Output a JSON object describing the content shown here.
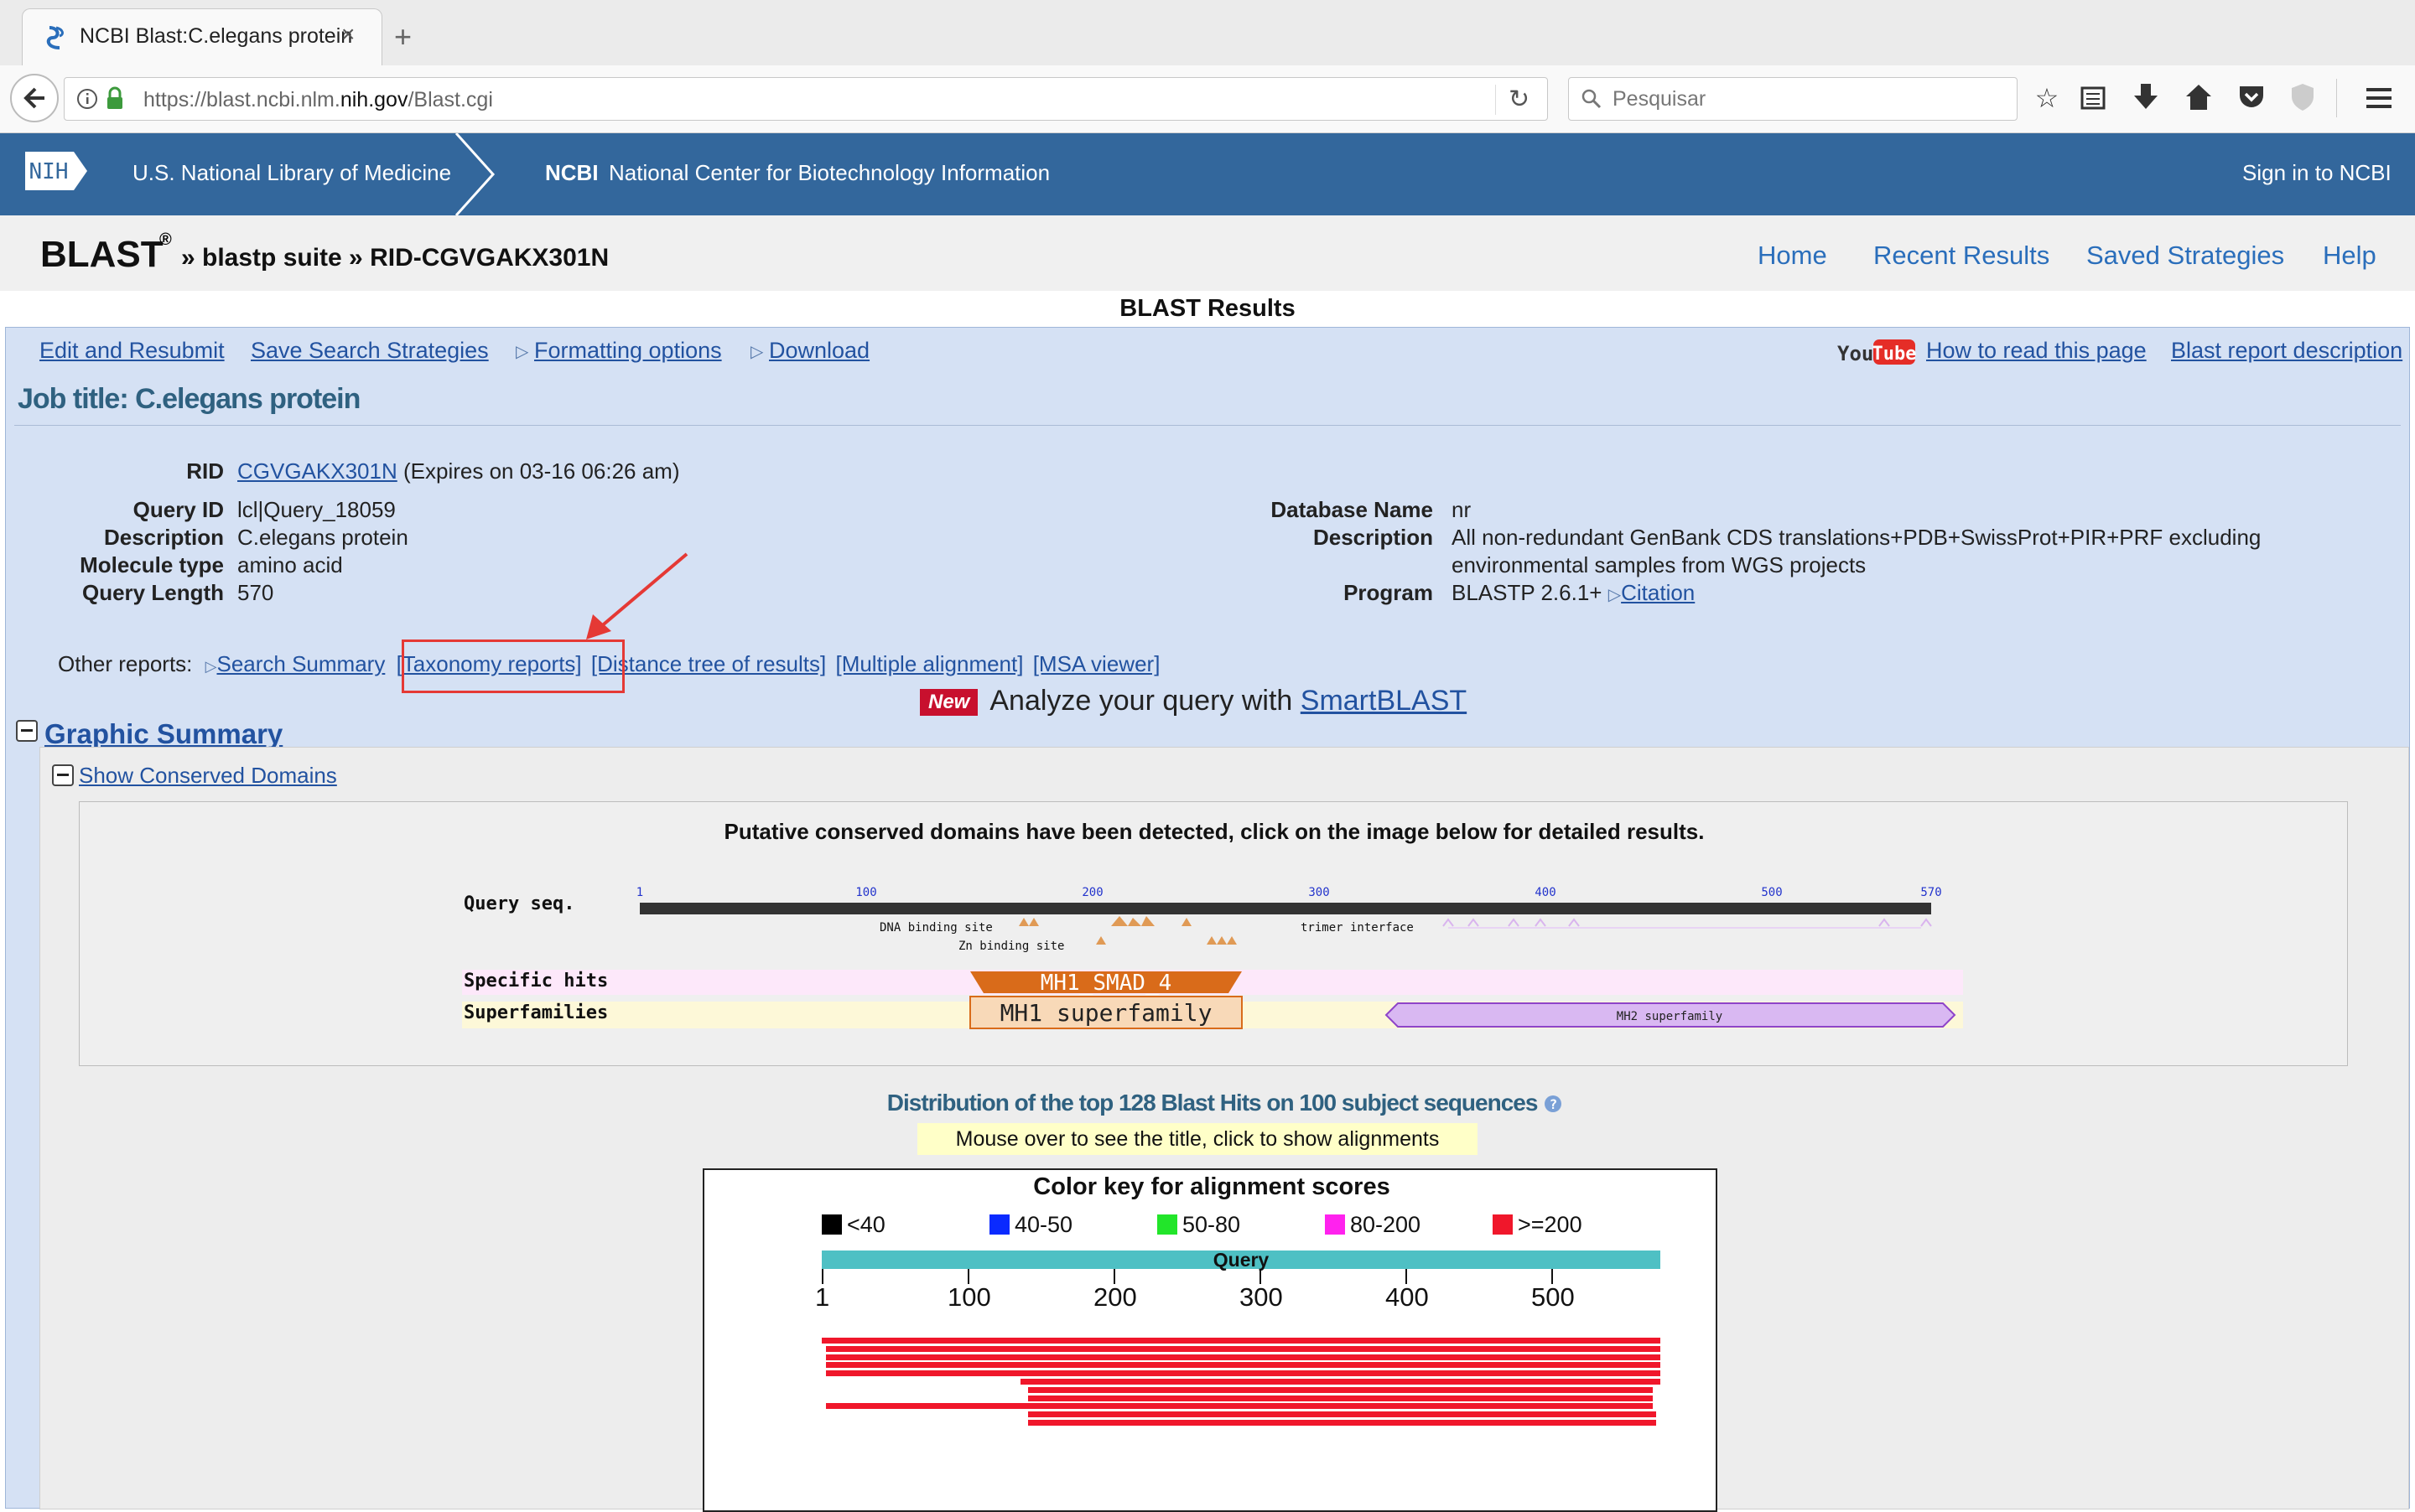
{
  "browser": {
    "tab_title": "NCBI Blast:C.elegans protein",
    "url_prefix": "https://blast.ncbi.nlm.",
    "url_domain": "nih.gov",
    "url_suffix": "/Blast.cgi",
    "search_placeholder": "Pesquisar"
  },
  "nih_bar": {
    "logo_text": "NIH",
    "library": "U.S. National Library of Medicine",
    "ncbi_short": "NCBI",
    "ncbi_full": "National Center for Biotechnology Information",
    "sign_in": "Sign in to NCBI"
  },
  "blast_header": {
    "title": "BLAST",
    "registered": "®",
    "breadcrumb": "» blastp suite » RID-CGVGAKX301N",
    "nav": [
      "Home",
      "Recent Results",
      "Saved Strategies",
      "Help"
    ]
  },
  "page_title": "BLAST Results",
  "toolbar": {
    "edit_resubmit": "Edit and Resubmit",
    "save_strategies": "Save Search Strategies",
    "formatting": "Formatting options ",
    "download": "Download",
    "youtube": "YouTube",
    "how_to_read": "How to read this page",
    "report_desc": "Blast report description"
  },
  "job_title": "Job title: C.elegans protein",
  "query_info": {
    "rid_label": "RID",
    "rid_value": "CGVGAKX301N",
    "rid_expiry": "(Expires on 03-16 06:26 am)",
    "query_id_label": "Query ID",
    "query_id": "lcl|Query_18059",
    "description_label": "Description",
    "description": "C.elegans protein",
    "molecule_type_label": "Molecule type",
    "molecule_type": "amino acid",
    "query_length_label": "Query Length",
    "query_length": "570"
  },
  "database_info": {
    "db_name_label": "Database Name",
    "db_name": "nr",
    "description_label": "Description",
    "description_line1": "All non-redundant GenBank CDS translations+PDB+SwissProt+PIR+PRF excluding",
    "description_line2": "environmental samples from WGS projects",
    "program_label": "Program",
    "program": "BLASTP 2.6.1+",
    "citation": "Citation"
  },
  "other_reports": {
    "label": "Other reports:",
    "search_summary": "Search Summary",
    "taxonomy": "[Taxonomy reports]",
    "distance_tree": "[Distance tree of results]",
    "multiple_alignment": "[Multiple alignment]",
    "msa_viewer": "[MSA viewer]"
  },
  "smartblast": {
    "badge": "New",
    "text": "Analyze your query with ",
    "link": "SmartBLAST"
  },
  "graphic_summary": {
    "heading": "Graphic Summary",
    "show_domains": "Show Conserved Domains",
    "domains_title": "Putative conserved domains have been detected, click on the image below for detailed results.",
    "domain_labels": {
      "query_seq": "Query seq.",
      "specific_hits": "Specific hits",
      "superfamilies": "Superfamilies",
      "dna_binding": "DNA binding site",
      "zn_binding": "Zn binding site",
      "trimer": "trimer interface",
      "specific_hit_name": "MH1_SMAD_4",
      "superfamily_1": "MH1 superfamily",
      "superfamily_2": "MH2 superfamily",
      "ruler_ticks": [
        "1",
        "100",
        "200",
        "300",
        "400",
        "500",
        "570"
      ]
    },
    "distribution_title": "Distribution of the top 128 Blast Hits on 100 subject sequences",
    "mouse_hint": "Mouse over to see the title, click to show alignments",
    "color_key_title": "Color key for alignment scores",
    "color_key": [
      {
        "label": "<40",
        "color": "#000000"
      },
      {
        "label": "40-50",
        "color": "#0a2aff"
      },
      {
        "label": "50-80",
        "color": "#22e52a"
      },
      {
        "label": "80-200",
        "color": "#ff22ee"
      },
      {
        "label": ">=200",
        "color": "#f0172b"
      }
    ],
    "query_label": "Query",
    "axis_ticks": [
      "1",
      "100",
      "200",
      "300",
      "400",
      "500"
    ]
  },
  "chart_data": {
    "type": "bar",
    "hits": [
      {
        "start": 1,
        "end": 570
      },
      {
        "start": 4,
        "end": 570
      },
      {
        "start": 4,
        "end": 570
      },
      {
        "start": 4,
        "end": 570
      },
      {
        "start": 4,
        "end": 570
      },
      {
        "start": 136,
        "end": 570
      },
      {
        "start": 141,
        "end": 565
      },
      {
        "start": 141,
        "end": 565
      },
      {
        "start": 4,
        "end": 565
      },
      {
        "start": 141,
        "end": 567
      },
      {
        "start": 141,
        "end": 567
      }
    ]
  }
}
